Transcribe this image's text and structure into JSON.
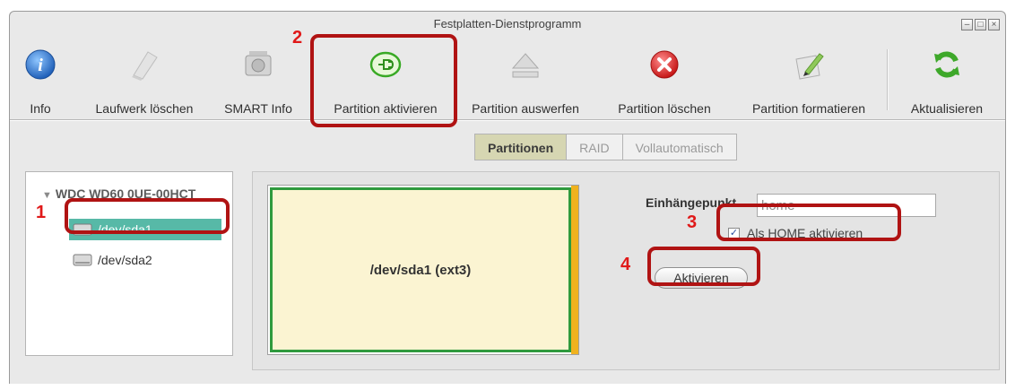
{
  "window": {
    "title": "Festplatten-Dienstprogramm"
  },
  "toolbar": {
    "items": [
      {
        "label": "Info",
        "icon": "info-icon"
      },
      {
        "label": "Laufwerk löschen",
        "icon": "eraser-icon"
      },
      {
        "label": "SMART Info",
        "icon": "drive-check-icon"
      },
      {
        "label": "Partition aktivieren",
        "icon": "plug-icon"
      },
      {
        "label": "Partition auswerfen",
        "icon": "eject-icon"
      },
      {
        "label": "Partition löschen",
        "icon": "delete-icon"
      },
      {
        "label": "Partition formatieren",
        "icon": "pencil-paper-icon"
      },
      {
        "label": "Aktualisieren",
        "icon": "refresh-icon"
      }
    ]
  },
  "tabs": [
    {
      "label": "Partitionen",
      "active": true
    },
    {
      "label": "RAID",
      "active": false
    },
    {
      "label": "Vollautomatisch",
      "active": false
    }
  ],
  "tree": {
    "root": "WDC WD60 0UE-00HCT",
    "items": [
      {
        "label": "/dev/sda1",
        "selected": true
      },
      {
        "label": "/dev/sda2",
        "selected": false
      }
    ]
  },
  "partition": {
    "label": "/dev/sda1 (ext3)"
  },
  "form": {
    "mount_label": "Einhängepunkt",
    "mount_value": "home",
    "home_checkbox_label": "Als HOME aktivieren",
    "home_checked": true,
    "activate_button": "Aktivieren"
  },
  "annotations": {
    "step1": "1",
    "step2": "2",
    "step3": "3",
    "step4": "4"
  },
  "colors": {
    "highlight": "#b01313",
    "step_number": "#e01919",
    "selection": "#57b9a7",
    "partition_fill": "#fbf4d2",
    "partition_border": "#2f9a3e"
  }
}
